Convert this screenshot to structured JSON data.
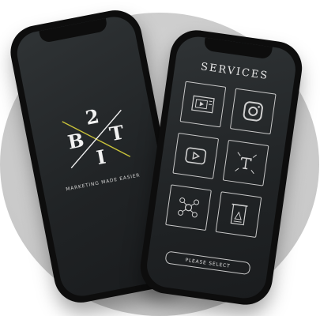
{
  "brand": {
    "logo_glyphs": [
      "2",
      "B",
      "T",
      "I"
    ],
    "tagline": "MARKETING MADE EASIER",
    "accent_color": "#c9c23a"
  },
  "services_screen": {
    "title": "SERVICES",
    "tiles": [
      {
        "icon": "video-edit-icon"
      },
      {
        "icon": "instagram-icon"
      },
      {
        "icon": "play-button-icon"
      },
      {
        "icon": "text-design-icon"
      },
      {
        "icon": "network-icon"
      },
      {
        "icon": "print-design-icon"
      }
    ],
    "select_label": "PLEASE SELECT"
  }
}
